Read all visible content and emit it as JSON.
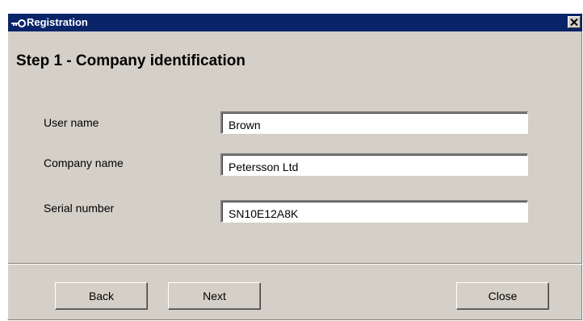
{
  "window": {
    "title": "Registration",
    "titlebar_color": "#0a246a",
    "background_color": "#d4d0c8",
    "title_icon": "key-icon",
    "close_icon": "close-icon"
  },
  "step": {
    "title": "Step 1 - Company identification"
  },
  "fields": [
    {
      "label": "User name",
      "value": "Brown"
    },
    {
      "label": "Company name",
      "value": "Petersson Ltd"
    },
    {
      "label": "Serial number",
      "value": "SN10E12A8K"
    }
  ],
  "buttons": {
    "back_label": "Back",
    "next_label": "Next",
    "close_label": "Close"
  }
}
